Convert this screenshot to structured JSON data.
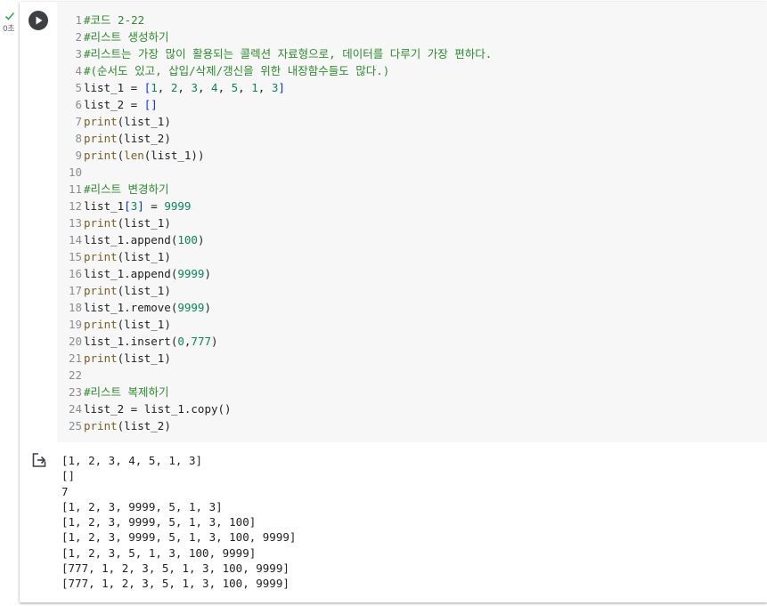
{
  "status": {
    "time_label": "0초",
    "check_color": "#34a853"
  },
  "run_button": {
    "icon": "play-icon"
  },
  "code_lines": [
    {
      "n": "1",
      "tokens": [
        {
          "t": "#코드 2-22",
          "c": "comment"
        }
      ]
    },
    {
      "n": "2",
      "tokens": [
        {
          "t": "#리스트 생성하기",
          "c": "comment"
        }
      ]
    },
    {
      "n": "3",
      "tokens": [
        {
          "t": "#리스트는 가장 많이 활용되는 콜렉션 자료형으로, 데이터를 다루기 가장 편하다.",
          "c": "comment"
        }
      ]
    },
    {
      "n": "4",
      "tokens": [
        {
          "t": "#(순서도 있고, 삽입/삭제/갱신을 위한 내장함수들도 많다.)",
          "c": "comment"
        }
      ]
    },
    {
      "n": "5",
      "tokens": [
        {
          "t": "list_1 = ",
          "c": "plain"
        },
        {
          "t": "[",
          "c": "bracket"
        },
        {
          "t": "1",
          "c": "num"
        },
        {
          "t": ", ",
          "c": "plain"
        },
        {
          "t": "2",
          "c": "num"
        },
        {
          "t": ", ",
          "c": "plain"
        },
        {
          "t": "3",
          "c": "num"
        },
        {
          "t": ", ",
          "c": "plain"
        },
        {
          "t": "4",
          "c": "num"
        },
        {
          "t": ", ",
          "c": "plain"
        },
        {
          "t": "5",
          "c": "num"
        },
        {
          "t": ", ",
          "c": "plain"
        },
        {
          "t": "1",
          "c": "num"
        },
        {
          "t": ", ",
          "c": "plain"
        },
        {
          "t": "3",
          "c": "num"
        },
        {
          "t": "]",
          "c": "bracket"
        }
      ]
    },
    {
      "n": "6",
      "tokens": [
        {
          "t": "list_2 = ",
          "c": "plain"
        },
        {
          "t": "[]",
          "c": "bracket"
        }
      ]
    },
    {
      "n": "7",
      "tokens": [
        {
          "t": "print",
          "c": "func"
        },
        {
          "t": "(list_1)",
          "c": "plain"
        }
      ]
    },
    {
      "n": "8",
      "tokens": [
        {
          "t": "print",
          "c": "func"
        },
        {
          "t": "(list_2)",
          "c": "plain"
        }
      ]
    },
    {
      "n": "9",
      "tokens": [
        {
          "t": "print",
          "c": "func"
        },
        {
          "t": "(",
          "c": "plain"
        },
        {
          "t": "len",
          "c": "func"
        },
        {
          "t": "(list_1))",
          "c": "plain"
        }
      ]
    },
    {
      "n": "10",
      "tokens": []
    },
    {
      "n": "11",
      "tokens": [
        {
          "t": "#리스트 변경하기",
          "c": "comment"
        }
      ]
    },
    {
      "n": "12",
      "tokens": [
        {
          "t": "list_1",
          "c": "plain"
        },
        {
          "t": "[",
          "c": "bracket"
        },
        {
          "t": "3",
          "c": "num"
        },
        {
          "t": "]",
          "c": "bracket"
        },
        {
          "t": " = ",
          "c": "plain"
        },
        {
          "t": "9999",
          "c": "num"
        }
      ]
    },
    {
      "n": "13",
      "tokens": [
        {
          "t": "print",
          "c": "func"
        },
        {
          "t": "(list_1)",
          "c": "plain"
        }
      ]
    },
    {
      "n": "14",
      "tokens": [
        {
          "t": "list_1.append(",
          "c": "plain"
        },
        {
          "t": "100",
          "c": "num"
        },
        {
          "t": ")",
          "c": "plain"
        }
      ]
    },
    {
      "n": "15",
      "tokens": [
        {
          "t": "print",
          "c": "func"
        },
        {
          "t": "(list_1)",
          "c": "plain"
        }
      ]
    },
    {
      "n": "16",
      "tokens": [
        {
          "t": "list_1.append(",
          "c": "plain"
        },
        {
          "t": "9999",
          "c": "num"
        },
        {
          "t": ")",
          "c": "plain"
        }
      ]
    },
    {
      "n": "17",
      "tokens": [
        {
          "t": "print",
          "c": "func"
        },
        {
          "t": "(list_1)",
          "c": "plain"
        }
      ]
    },
    {
      "n": "18",
      "tokens": [
        {
          "t": "list_1.remove(",
          "c": "plain"
        },
        {
          "t": "9999",
          "c": "num"
        },
        {
          "t": ")",
          "c": "plain"
        }
      ]
    },
    {
      "n": "19",
      "tokens": [
        {
          "t": "print",
          "c": "func"
        },
        {
          "t": "(list_1)",
          "c": "plain"
        }
      ]
    },
    {
      "n": "20",
      "tokens": [
        {
          "t": "list_1.insert(",
          "c": "plain"
        },
        {
          "t": "0",
          "c": "num"
        },
        {
          "t": ",",
          "c": "plain"
        },
        {
          "t": "777",
          "c": "num"
        },
        {
          "t": ")",
          "c": "plain"
        }
      ]
    },
    {
      "n": "21",
      "tokens": [
        {
          "t": "print",
          "c": "func"
        },
        {
          "t": "(list_1)",
          "c": "plain"
        }
      ]
    },
    {
      "n": "22",
      "tokens": []
    },
    {
      "n": "23",
      "tokens": [
        {
          "t": "#리스트 복제하기",
          "c": "comment"
        }
      ]
    },
    {
      "n": "24",
      "tokens": [
        {
          "t": "list_2 = list_1.copy()",
          "c": "plain"
        }
      ]
    },
    {
      "n": "25",
      "tokens": [
        {
          "t": "print",
          "c": "func"
        },
        {
          "t": "(list_2)",
          "c": "plain"
        }
      ]
    }
  ],
  "output": {
    "icon": "output-redirect-icon",
    "lines": [
      "[1, 2, 3, 4, 5, 1, 3]",
      "[]",
      "7",
      "[1, 2, 3, 9999, 5, 1, 3]",
      "[1, 2, 3, 9999, 5, 1, 3, 100]",
      "[1, 2, 3, 9999, 5, 1, 3, 100, 9999]",
      "[1, 2, 3, 5, 1, 3, 100, 9999]",
      "[777, 1, 2, 3, 5, 1, 3, 100, 9999]",
      "[777, 1, 2, 3, 5, 1, 3, 100, 9999]"
    ]
  }
}
